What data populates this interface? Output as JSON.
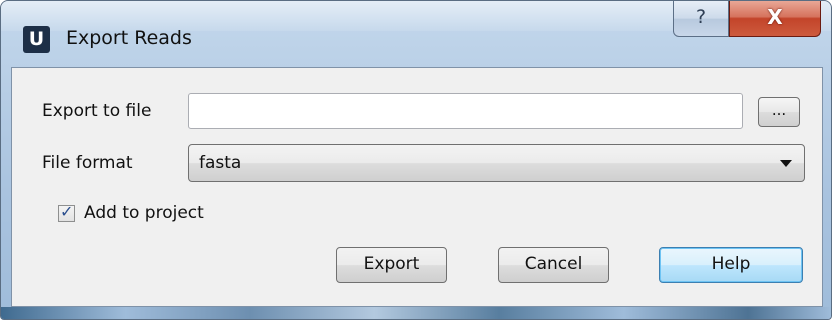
{
  "window": {
    "title": "Export Reads",
    "app_icon_letter": "U",
    "help_button_glyph": "?",
    "close_button_glyph": "X"
  },
  "form": {
    "export_to_file_label": "Export to file",
    "export_to_file_value": "",
    "browse_label": "...",
    "file_format_label": "File format",
    "file_format_value": "fasta",
    "add_to_project_label": "Add to project",
    "add_to_project_checked": true
  },
  "buttons": {
    "export": "Export",
    "cancel": "Cancel",
    "help": "Help"
  },
  "icons": {
    "app": "ugene-logo-icon",
    "help": "question-mark-icon",
    "close": "close-icon",
    "dropdown": "chevron-down-icon",
    "check": "checkmark-icon"
  },
  "colors": {
    "frame": "#b6cde5",
    "close_button": "#c3442a",
    "default_button_border": "#3c7fb1",
    "dialog_background": "#f0f0f0"
  }
}
